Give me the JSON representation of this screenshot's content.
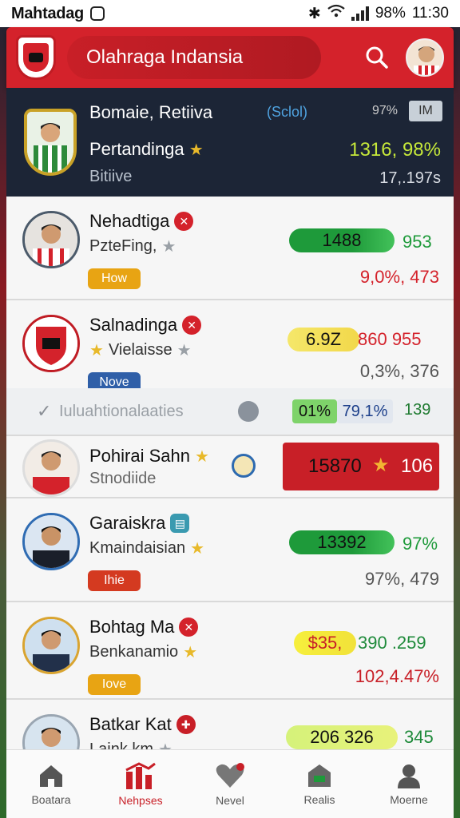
{
  "status_bar": {
    "app_name": "Mahtadag",
    "battery": "98%",
    "time": "11:30"
  },
  "header": {
    "title": "Olahraga Indansia"
  },
  "summary": {
    "title": "Bomaie, Retiiva",
    "scroll_label": "(Sclol)",
    "percent_label": "97%",
    "box_label": "IM",
    "subtitle": "Pertandinga",
    "detail": "Bitiive",
    "value_main": "1316, 98%",
    "value_sub": "17,.197s"
  },
  "players": [
    {
      "name": "Nehadtiga",
      "sub": "PzteFing,",
      "tag": "How",
      "pill_value": "1488",
      "right_value": "953",
      "row2": "9,0%, 473"
    },
    {
      "name": "Salnadinga",
      "sub": "Vielaisse",
      "tag": "Nove",
      "pill_value": "6.9Z",
      "right_value": "860  955",
      "row2": "0,3%, 376",
      "extra_label": "Iuluahtionalaaties",
      "extra_pill1": "01%",
      "extra_pill2": "79,1%",
      "extra_val": "139"
    },
    {
      "name": "Pohirai Sahn",
      "sub": "Stnodiide",
      "pill_value": "15870",
      "right_value": "106"
    },
    {
      "name": "Garaiskra",
      "sub": "Kmaindaisian",
      "tag": "Ihie",
      "pill_value": "13392",
      "right_value": "97%",
      "row2": "97%, 479"
    },
    {
      "name": "Bohtag Ma",
      "sub": "Benkanamio",
      "tag": "Iove",
      "pill_value": "$35,",
      "right_value": "390 .259",
      "row2": "102,4.47%"
    },
    {
      "name": "Batkar Kat",
      "sub": "Laink km",
      "pill_value": "206 326",
      "right_value": "345"
    }
  ],
  "nav": [
    {
      "label": "Boatara",
      "icon": "home-icon"
    },
    {
      "label": "Nehpses",
      "icon": "stats-icon"
    },
    {
      "label": "Nevel",
      "icon": "heart-icon"
    },
    {
      "label": "Realis",
      "icon": "shop-icon"
    },
    {
      "label": "Moerne",
      "icon": "user-icon"
    }
  ],
  "colors": {
    "accent_red": "#d4222b",
    "green": "#1e9a3a",
    "yellow": "#f2e04a",
    "navy": "#1c2536"
  }
}
